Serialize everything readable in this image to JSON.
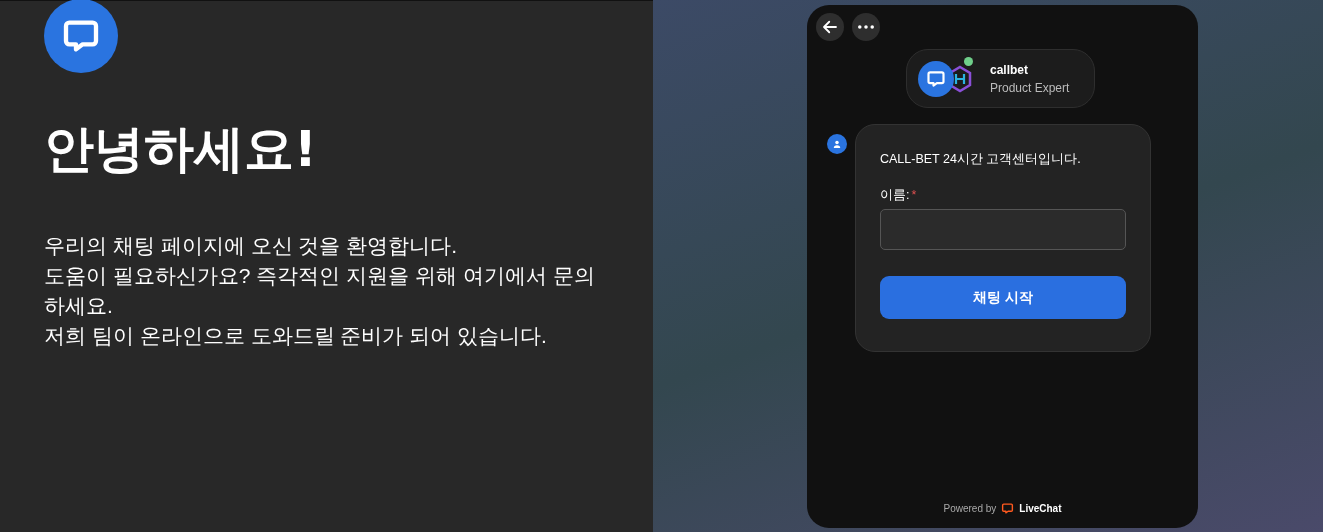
{
  "hero": {
    "title": "안녕하세요!",
    "lines": [
      "우리의 채팅 페이지에 오신 것을 환영합니다.",
      "도움이 필요하신가요? 즉각적인 지원을 위해 여기에서 문의하세요.",
      "저희 팀이 온라인으로 도와드릴 준비가 되어 있습니다."
    ]
  },
  "widget": {
    "agent": {
      "name": "callbet",
      "role": "Product Expert",
      "online": true
    },
    "message": {
      "text": "CALL-BET 24시간 고객센터입니다.",
      "field_label": "이름:",
      "required_mark": "*",
      "button": "채팅 시작"
    },
    "footer": {
      "powered": "Powered by",
      "brand": "LiveChat"
    }
  }
}
